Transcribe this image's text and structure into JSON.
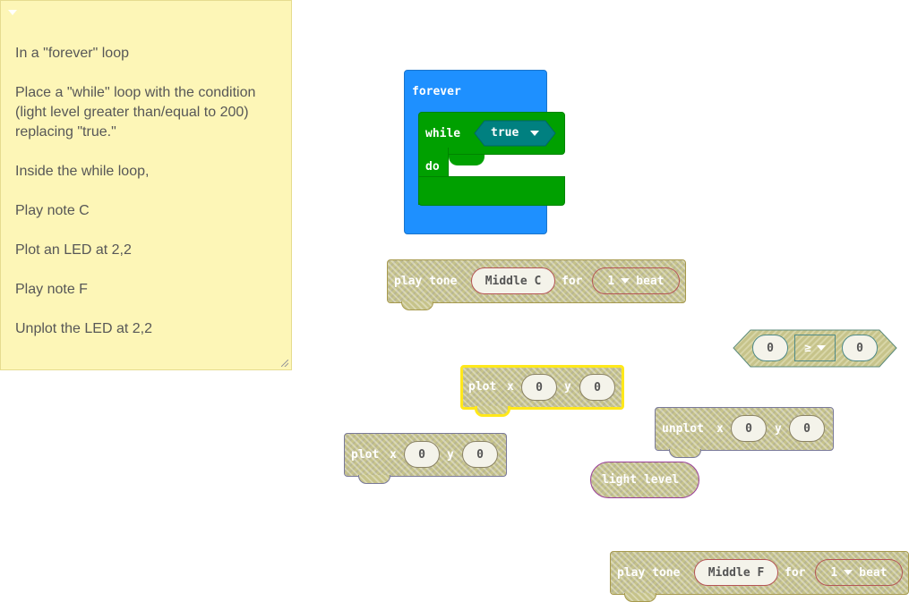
{
  "comment": {
    "lines": [
      "In a \"forever\" loop",
      "Place a \"while\" loop with the condition (light level greater than/equal to 200) replacing \"true.\"",
      "Inside the while loop,",
      "Play note C",
      "Plot an LED at 2,2",
      "Play note F",
      "Unplot the LED at 2,2"
    ]
  },
  "forever_block": {
    "label": "forever"
  },
  "while_block": {
    "while_label": "while",
    "condition": "true",
    "do_label": "do"
  },
  "play_tone_c": {
    "label": "play tone",
    "note": "Middle C",
    "for_label": "for",
    "beat_value": "1",
    "beat_label": "beat"
  },
  "compare_block": {
    "left": "0",
    "operator": "≥",
    "right": "0"
  },
  "plot_selected": {
    "label": "plot",
    "x_label": "x",
    "x": "0",
    "y_label": "y",
    "y": "0"
  },
  "unplot": {
    "label": "unplot",
    "x_label": "x",
    "x": "0",
    "y_label": "y",
    "y": "0"
  },
  "plot_other": {
    "label": "plot",
    "x_label": "x",
    "x": "0",
    "y_label": "y",
    "y": "0"
  },
  "light_level": {
    "label": "light level"
  },
  "play_tone_f": {
    "label": "play tone",
    "note": "Middle F",
    "for_label": "for",
    "beat_value": "1",
    "beat_label": "beat"
  },
  "colors": {
    "event_blue": "#1e90ff",
    "loop_green": "#00a000",
    "logic_teal": "#008080",
    "disabled_fill": "#c6c38a",
    "comment_yellow": "#fdf6b7",
    "selected_outline": "#ffe81a"
  }
}
